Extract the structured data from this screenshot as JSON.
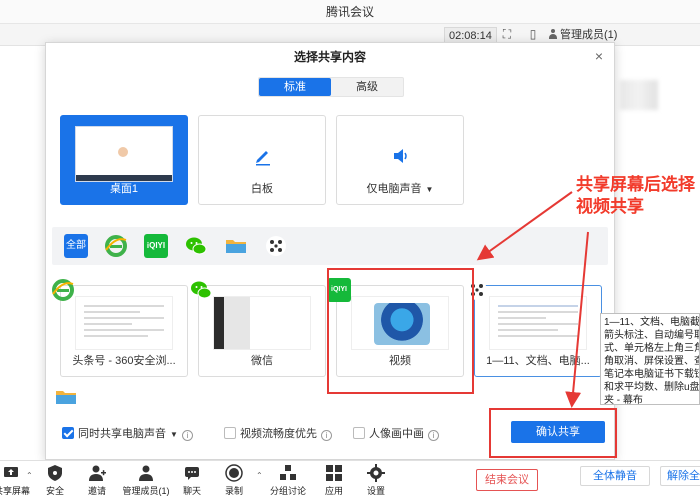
{
  "app": {
    "title": "腾讯会议"
  },
  "topbar": {
    "timer": "02:08:14",
    "members_label": "管理成员(1)"
  },
  "dialog": {
    "title": "选择共享内容",
    "tabs": [
      {
        "label": "标准",
        "active": true
      },
      {
        "label": "高级",
        "active": false
      }
    ],
    "share_options": [
      {
        "label": "桌面1",
        "selected": true,
        "icon": "desktop-icon"
      },
      {
        "label": "白板",
        "selected": false,
        "icon": "pen-icon"
      },
      {
        "label": "仅电脑声音",
        "selected": false,
        "icon": "speaker-icon"
      }
    ],
    "filters": [
      {
        "label": "全部",
        "icon": "all-icon"
      },
      {
        "label": "",
        "icon": "ie-icon"
      },
      {
        "label": "iQIYI",
        "icon": "iqiyi-icon"
      },
      {
        "label": "",
        "icon": "wechat-icon"
      },
      {
        "label": "",
        "icon": "folder-icon"
      },
      {
        "label": "",
        "icon": "meeting-icon"
      }
    ],
    "windows": [
      {
        "label": "头条号 - 360安全浏...",
        "icon": "ie-icon"
      },
      {
        "label": "微信",
        "icon": "wechat-icon"
      },
      {
        "label": "视频",
        "icon": "iqiyi-icon"
      },
      {
        "label": "1—11、文档、电脑...",
        "icon": "meeting-icon"
      }
    ],
    "options": [
      {
        "label": "同时共享电脑声音",
        "checked": true
      },
      {
        "label": "视频流畅度优先",
        "checked": false
      },
      {
        "label": "人像画中画",
        "checked": false
      }
    ],
    "confirm_label": "确认共享"
  },
  "tooltip": {
    "lines": [
      "1—11、文档、电脑截",
      "箭头标注、自动编号取",
      "式、单元格左上角三角",
      "角取消、屏保设置、查",
      "笔记本电脑证书下载钮",
      "和求平均数、删除u盘里",
      "夹 - 幕布"
    ]
  },
  "annotation": {
    "text": "共享屏幕后选择视频共享"
  },
  "toolbar": {
    "items": [
      {
        "label": "共享屏幕",
        "icon": "share-screen-icon"
      },
      {
        "label": "安全",
        "icon": "shield-icon"
      },
      {
        "label": "邀请",
        "icon": "invite-icon"
      },
      {
        "label": "管理成员(1)",
        "icon": "members-icon"
      },
      {
        "label": "聊天",
        "icon": "chat-icon"
      },
      {
        "label": "录制",
        "icon": "record-icon"
      },
      {
        "label": "分组讨论",
        "icon": "breakout-icon"
      },
      {
        "label": "应用",
        "icon": "apps-icon"
      },
      {
        "label": "设置",
        "icon": "gear-icon"
      }
    ],
    "end_label": "结束会议",
    "mute_all_label": "全体静音",
    "unmute_all_label": "解除全体静音"
  },
  "colors": {
    "accent": "#1a73e8",
    "danger": "#e53935",
    "annotation": "#f23b2b",
    "iqiyi": "#15b93a"
  }
}
